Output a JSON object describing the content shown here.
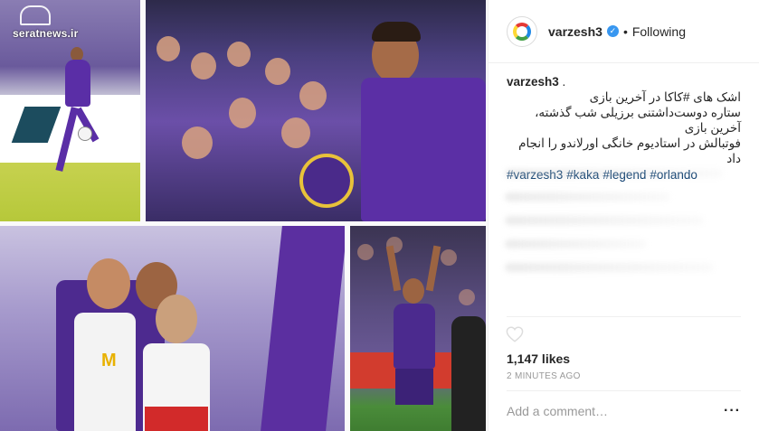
{
  "header": {
    "username": "varzesh3",
    "verified_mark": "✓",
    "separator": "•",
    "follow_state": "Following"
  },
  "caption": {
    "username": "varzesh3",
    "lead": " .",
    "lines": [
      "اشک های #کاکا در آخرین بازی",
      "ستاره دوست‌داشتنی برزیلی شب گذشته، آخرین بازی",
      "فوتبالش در استادیوم خانگی اورلاندو را انجام داد"
    ],
    "hashtags": [
      "#varzesh3",
      "#kaka",
      "#legend",
      "#orlando"
    ]
  },
  "photo": {
    "watermark": "seratnews.ir"
  },
  "likes": "1,147 likes",
  "time": "2 MINUTES AGO",
  "comment": {
    "placeholder": "Add a comment…"
  },
  "icons": {
    "avatar": "varzesh3-logo-icon",
    "verified": "verified-badge-icon",
    "heart": "heart-icon",
    "more": "more-options-icon"
  }
}
